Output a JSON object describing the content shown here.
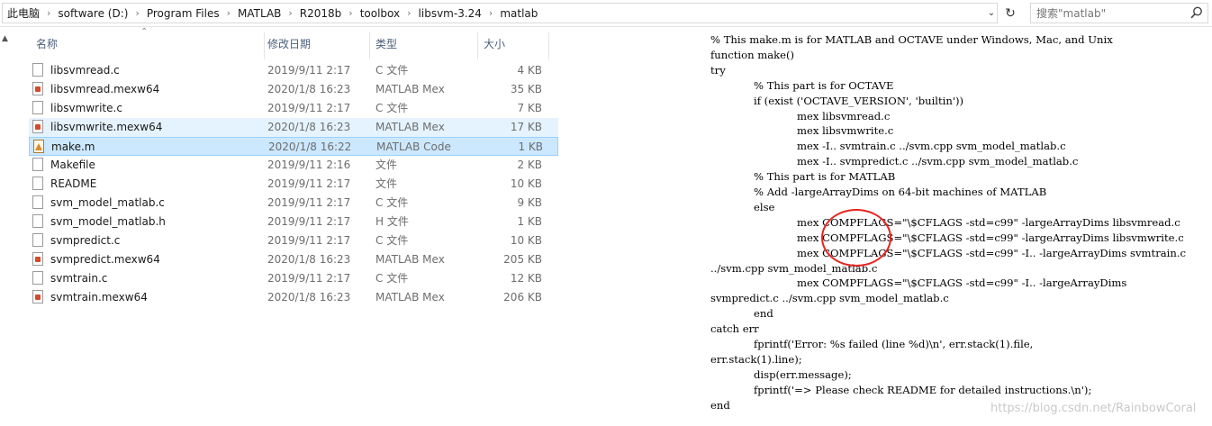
{
  "address": {
    "crumbs": [
      "此电脑",
      "software (D:)",
      "Program Files",
      "MATLAB",
      "R2018b",
      "toolbox",
      "libsvm-3.24",
      "matlab"
    ]
  },
  "search": {
    "placeholder": "搜索\"matlab\""
  },
  "columns": {
    "name": "名称",
    "date": "修改日期",
    "type": "类型",
    "size": "大小"
  },
  "files": [
    {
      "name": "libsvmread.c",
      "date": "2019/9/11 2:17",
      "type": "C 文件",
      "size": "4 KB",
      "icon": "c-file"
    },
    {
      "name": "libsvmread.mexw64",
      "date": "2020/1/8 16:23",
      "type": "MATLAB Mex",
      "size": "35 KB",
      "icon": "mex-file"
    },
    {
      "name": "libsvmwrite.c",
      "date": "2019/9/11 2:17",
      "type": "C 文件",
      "size": "7 KB",
      "icon": "c-file"
    },
    {
      "name": "libsvmwrite.mexw64",
      "date": "2020/1/8 16:23",
      "type": "MATLAB Mex",
      "size": "17 KB",
      "icon": "mex-file"
    },
    {
      "name": "make.m",
      "date": "2020/1/8 16:22",
      "type": "MATLAB Code",
      "size": "1 KB",
      "icon": "m-file"
    },
    {
      "name": "Makefile",
      "date": "2019/9/11 2:16",
      "type": "文件",
      "size": "2 KB",
      "icon": "file"
    },
    {
      "name": "README",
      "date": "2019/9/11 2:17",
      "type": "文件",
      "size": "10 KB",
      "icon": "file"
    },
    {
      "name": "svm_model_matlab.c",
      "date": "2019/9/11 2:17",
      "type": "C 文件",
      "size": "9 KB",
      "icon": "c-file"
    },
    {
      "name": "svm_model_matlab.h",
      "date": "2019/9/11 2:17",
      "type": "H 文件",
      "size": "1 KB",
      "icon": "h-file"
    },
    {
      "name": "svmpredict.c",
      "date": "2019/9/11 2:17",
      "type": "C 文件",
      "size": "10 KB",
      "icon": "c-file"
    },
    {
      "name": "svmpredict.mexw64",
      "date": "2020/1/8 16:23",
      "type": "MATLAB Mex",
      "size": "205 KB",
      "icon": "mex-file"
    },
    {
      "name": "svmtrain.c",
      "date": "2019/9/11 2:17",
      "type": "C 文件",
      "size": "12 KB",
      "icon": "c-file"
    },
    {
      "name": "svmtrain.mexw64",
      "date": "2020/1/8 16:23",
      "type": "MATLAB Mex",
      "size": "206 KB",
      "icon": "mex-file"
    }
  ],
  "selected_index": 4,
  "hover_index": 3,
  "code_lines": [
    {
      "indent": 0,
      "text": "% This make.m is for MATLAB and OCTAVE under Windows, Mac, and Unix"
    },
    {
      "indent": 0,
      "text": "function make()"
    },
    {
      "indent": 0,
      "text": "try"
    },
    {
      "indent": 1,
      "text": "% This part is for OCTAVE"
    },
    {
      "indent": 1,
      "text": "if (exist ('OCTAVE_VERSION', 'builtin'))"
    },
    {
      "indent": 2,
      "text": "mex libsvmread.c"
    },
    {
      "indent": 2,
      "text": "mex libsvmwrite.c"
    },
    {
      "indent": 2,
      "text": "mex -I.. svmtrain.c ../svm.cpp svm_model_matlab.c"
    },
    {
      "indent": 2,
      "text": "mex -I.. svmpredict.c ../svm.cpp svm_model_matlab.c"
    },
    {
      "indent": 1,
      "text": "% This part is for MATLAB"
    },
    {
      "indent": 1,
      "text": "% Add -largeArrayDims on 64-bit machines of MATLAB"
    },
    {
      "indent": 1,
      "text": "else"
    },
    {
      "indent": 2,
      "text": "mex COMPFLAGS=\"\\$CFLAGS -std=c99\" -largeArrayDims libsvmread.c"
    },
    {
      "indent": 2,
      "text": "mex COMPFLAGS=\"\\$CFLAGS -std=c99\" -largeArrayDims libsvmwrite.c"
    },
    {
      "indent": 2,
      "text": "mex COMPFLAGS=\"\\$CFLAGS -std=c99\" -I.. -largeArrayDims svmtrain.c"
    },
    {
      "indent": 0,
      "text": "../svm.cpp svm_model_matlab.c"
    },
    {
      "indent": 2,
      "text": "mex COMPFLAGS=\"\\$CFLAGS -std=c99\" -I.. -largeArrayDims"
    },
    {
      "indent": 0,
      "text": "svmpredict.c ../svm.cpp svm_model_matlab.c"
    },
    {
      "indent": 1,
      "text": "end"
    },
    {
      "indent": 0,
      "text": "catch err"
    },
    {
      "indent": 1,
      "text": "fprintf('Error: %s failed (line %d)\\n', err.stack(1).file,"
    },
    {
      "indent": 0,
      "text": "err.stack(1).line);"
    },
    {
      "indent": 1,
      "text": "disp(err.message);"
    },
    {
      "indent": 1,
      "text": "fprintf('=> Please check README for detailed instructions.\\n');"
    },
    {
      "indent": 0,
      "text": "end"
    }
  ],
  "watermark": "https://blog.csdn.net/RainbowCoral",
  "colors": {
    "selection": "#cce8ff",
    "hover": "#e5f3ff",
    "annotation": "#e8241f"
  }
}
